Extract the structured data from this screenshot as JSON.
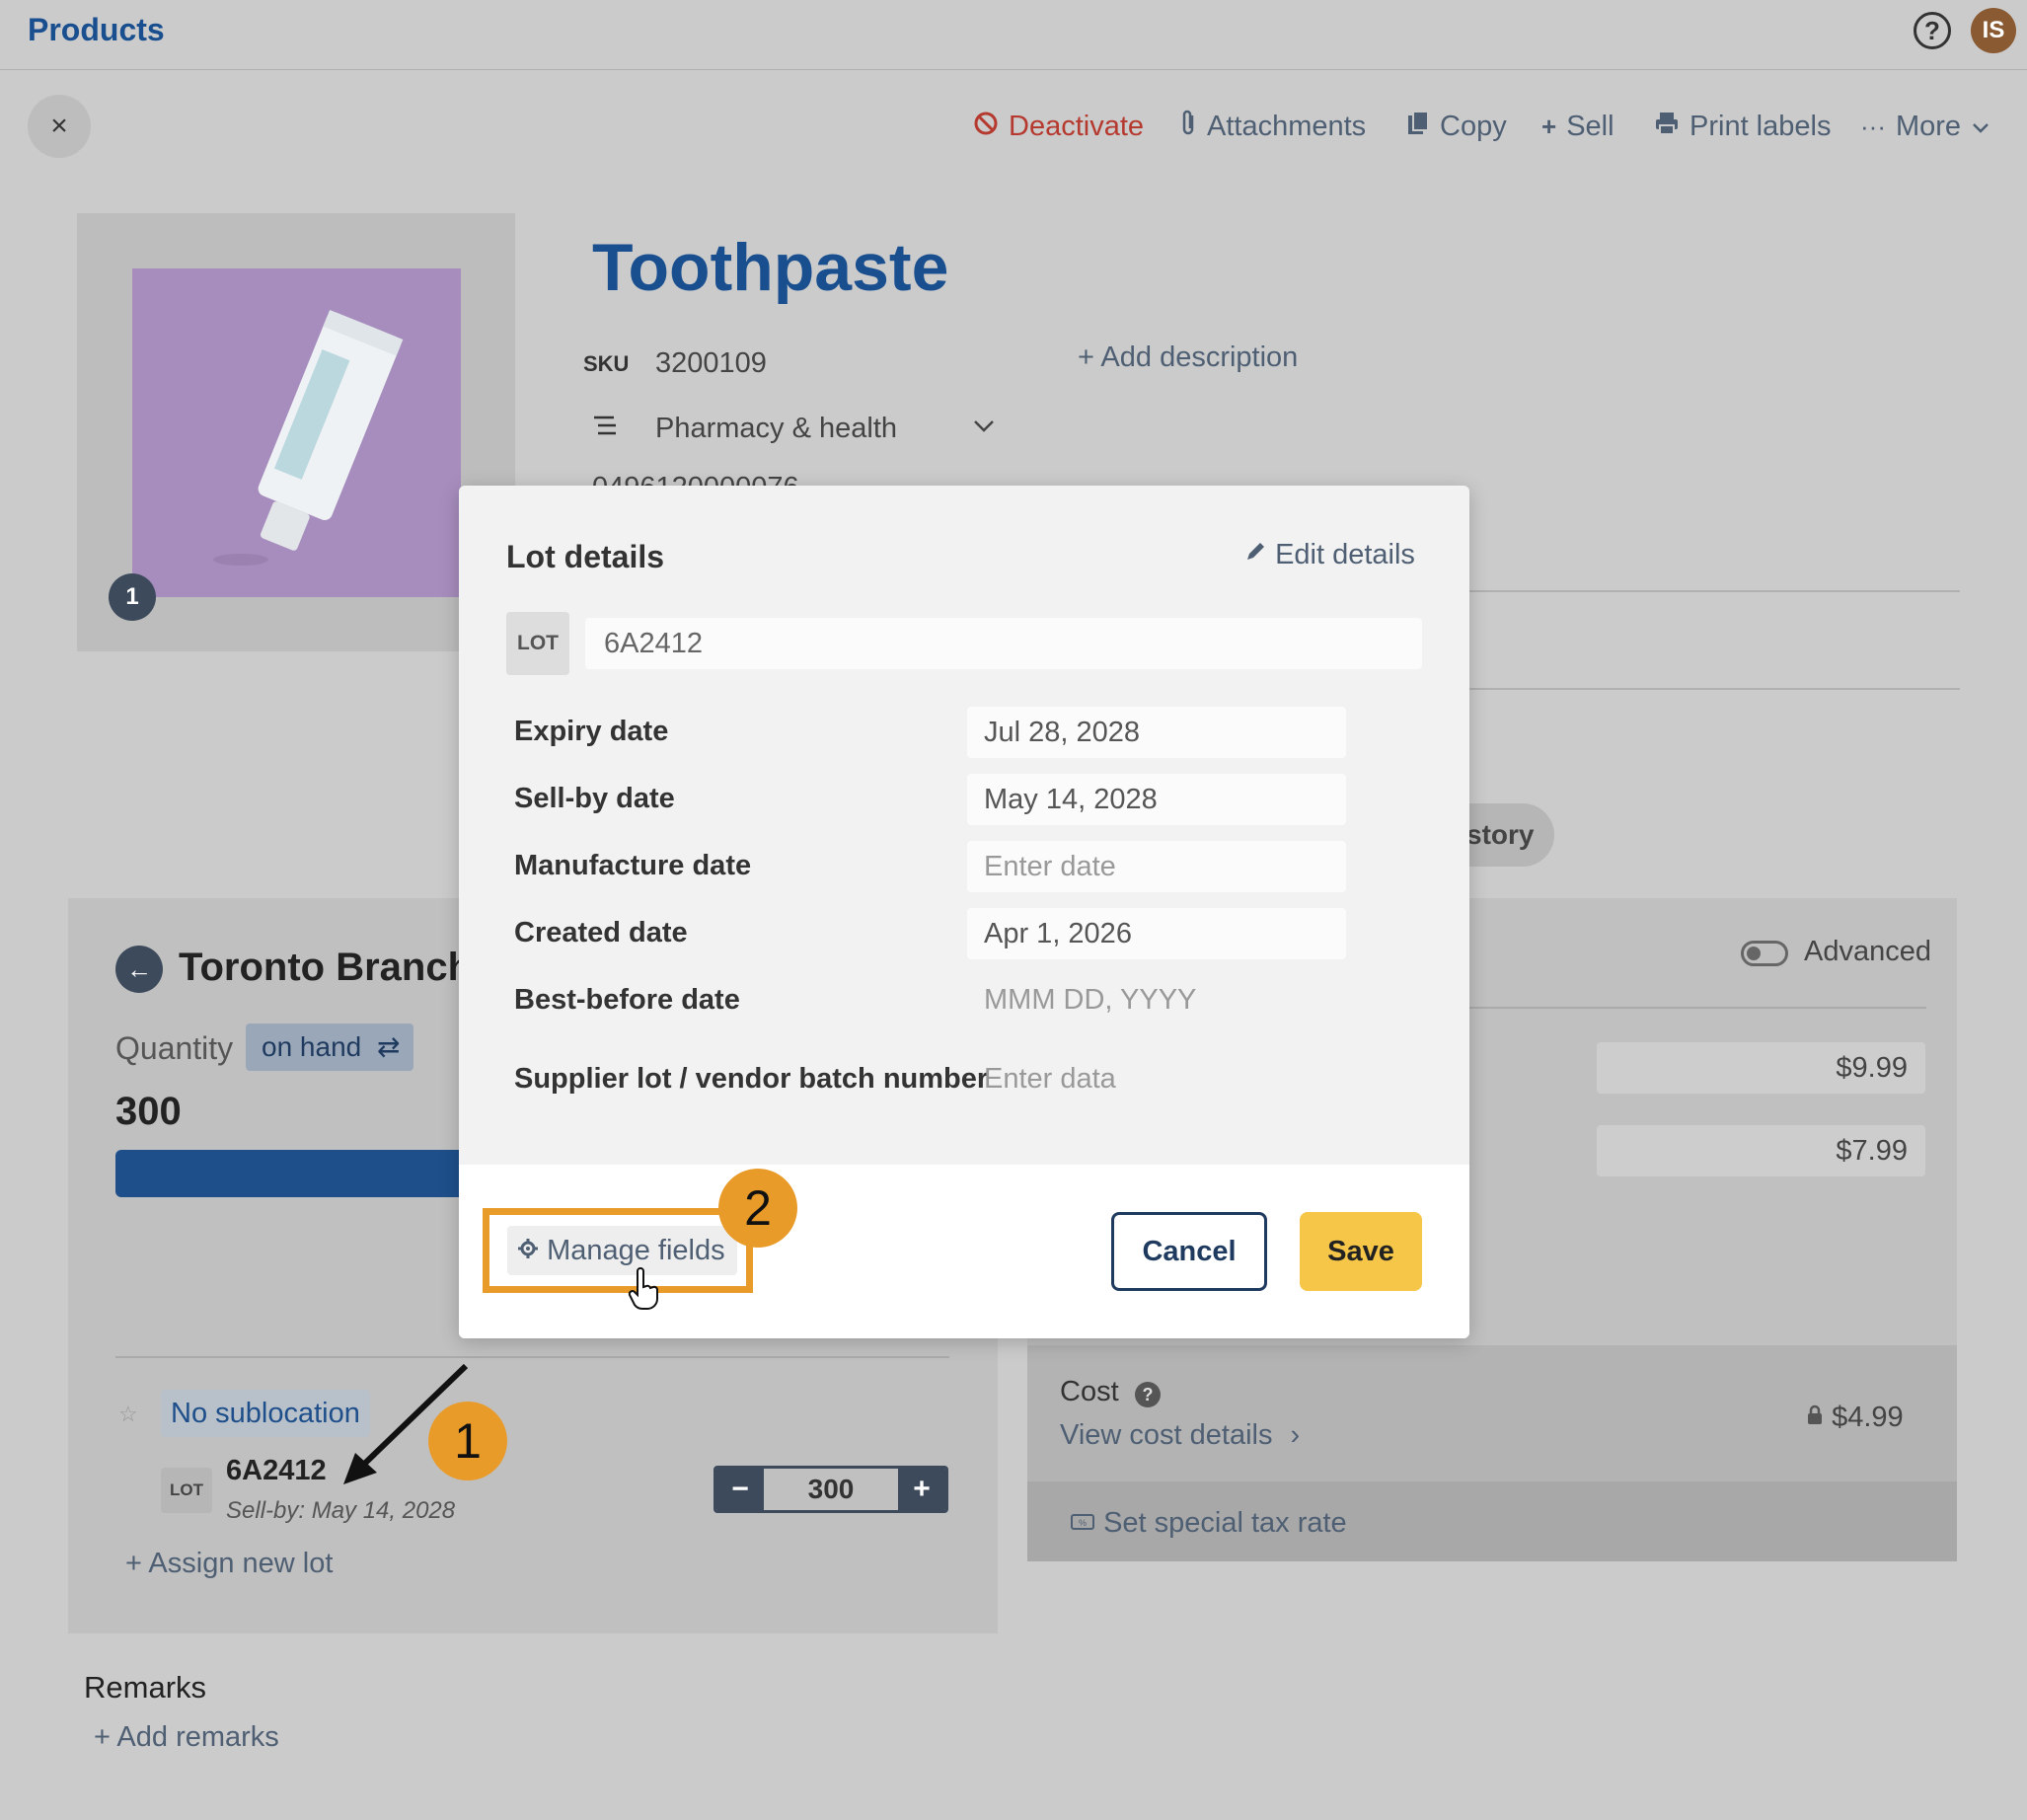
{
  "header": {
    "title": "Products",
    "help_icon": "?",
    "avatar_initials": "IS"
  },
  "toolbar": {
    "close_glyph": "×",
    "deactivate": "Deactivate",
    "attachments": "Attachments",
    "copy": "Copy",
    "sell": "Sell",
    "print_labels": "Print labels",
    "more": "More"
  },
  "product": {
    "name": "Toothpaste",
    "image_count": "1",
    "sku_label": "SKU",
    "sku": "3200109",
    "add_description": "Add description",
    "category": "Pharmacy & health",
    "barcode_partial": "0496120000076"
  },
  "tabs": {
    "history_partial": "story"
  },
  "branch": {
    "name": "Toronto Branch",
    "quantity_label": "Quantity",
    "quantity_mode": "on hand",
    "quantity": "300",
    "sublocation": "No sublocation",
    "lot_badge": "LOT",
    "lot_code": "6A2412",
    "lot_sellby": "Sell-by: May 14, 2028",
    "lot_quantity": "300",
    "assign_new_lot": "Assign new lot"
  },
  "pricing": {
    "advanced_label": "Advanced",
    "price_1": "$9.99",
    "price_2": "$7.99",
    "cost_label": "Cost",
    "cost_help": "?",
    "view_cost_details": "View cost details",
    "cost_value": "$4.99",
    "special_tax": "Set special tax rate"
  },
  "remarks": {
    "label": "Remarks",
    "add": "Add remarks"
  },
  "modal": {
    "title": "Lot details",
    "edit_details": "Edit details",
    "lot_badge": "LOT",
    "lot_value": "6A2412",
    "fields": [
      {
        "label": "Expiry date",
        "value": "Jul 28, 2028",
        "placeholder": ""
      },
      {
        "label": "Sell-by date",
        "value": "May 14, 2028",
        "placeholder": ""
      },
      {
        "label": "Manufacture date",
        "value": "",
        "placeholder": "Enter date"
      },
      {
        "label": "Created date",
        "value": "Apr 1, 2026",
        "placeholder": ""
      },
      {
        "label": "Best-before date",
        "value": "",
        "placeholder": "MMM DD, YYYY"
      },
      {
        "label": "Supplier lot / vendor batch number",
        "value": "",
        "placeholder": "Enter data"
      }
    ],
    "manage_fields": "Manage fields",
    "cancel": "Cancel",
    "save": "Save"
  },
  "callouts": {
    "one": "1",
    "two": "2"
  },
  "colors": {
    "brand_blue": "#1a4f8f",
    "accent_orange": "#e99b2a",
    "save_yellow": "#f5c647",
    "danger_red": "#b5392e"
  }
}
